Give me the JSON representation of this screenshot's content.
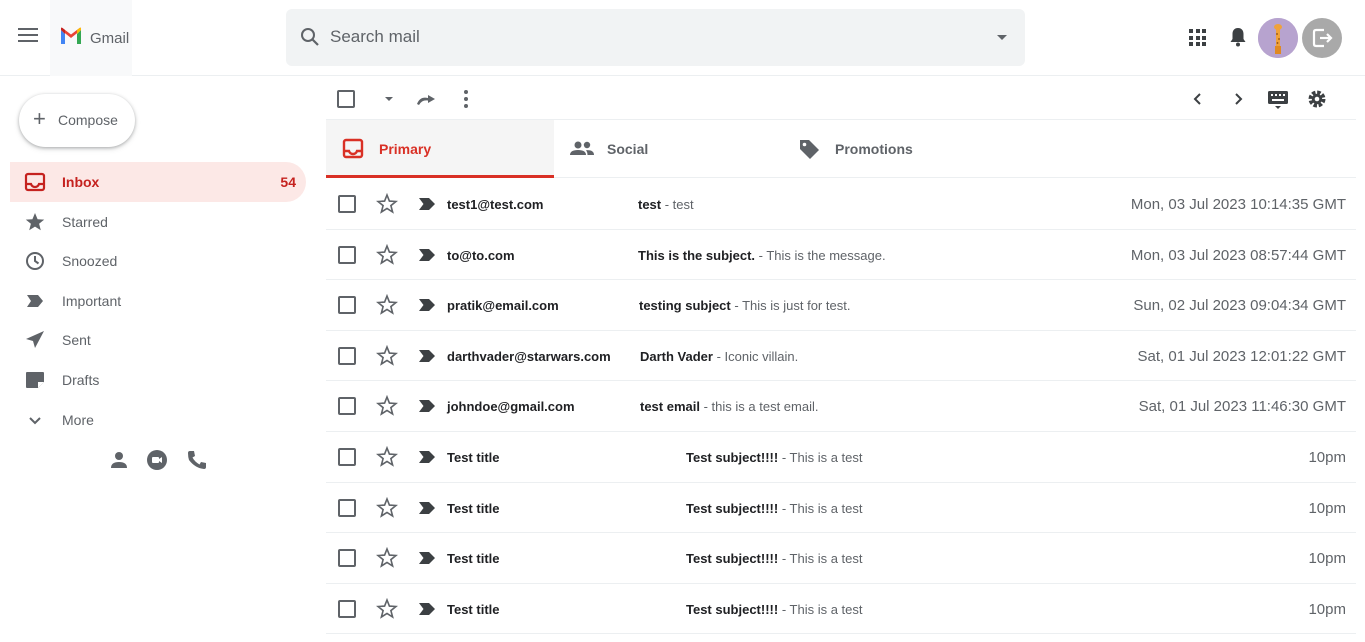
{
  "app": {
    "name": "Gmail"
  },
  "search": {
    "placeholder": "Search mail"
  },
  "sidebar": {
    "compose_label": "Compose",
    "items": [
      {
        "label": "Inbox",
        "icon": "inbox-icon",
        "count": "54",
        "active": true
      },
      {
        "label": "Starred",
        "icon": "star-icon"
      },
      {
        "label": "Snoozed",
        "icon": "clock-icon"
      },
      {
        "label": "Important",
        "icon": "important-icon"
      },
      {
        "label": "Sent",
        "icon": "send-icon"
      },
      {
        "label": "Drafts",
        "icon": "draft-icon"
      },
      {
        "label": "More",
        "icon": "chevron-down-icon"
      }
    ]
  },
  "tabs": [
    {
      "label": "Primary",
      "icon": "inbox-tab-icon",
      "active": true
    },
    {
      "label": "Social",
      "icon": "people-icon"
    },
    {
      "label": "Promotions",
      "icon": "tag-icon"
    }
  ],
  "emails": [
    {
      "sender": "test1@test.com",
      "subject": "test",
      "snippet": " - test",
      "date": "Mon, 03 Jul 2023 10:14:35 GMT"
    },
    {
      "sender": "to@to.com",
      "subject": "This is the subject.",
      "snippet": " - This is the message.",
      "date": "Mon, 03 Jul 2023 08:57:44 GMT"
    },
    {
      "sender": "pratik@email.com",
      "subject": "testing subject",
      "snippet": " - This is just for test.",
      "date": "Sun, 02 Jul 2023 09:04:34 GMT"
    },
    {
      "sender": "darthvader@starwars.com",
      "subject": "Darth Vader",
      "snippet": " - Iconic villain.",
      "date": "Sat, 01 Jul 2023 12:01:22 GMT"
    },
    {
      "sender": "johndoe@gmail.com",
      "subject": "test email",
      "snippet": " - this is a test email.",
      "date": "Sat, 01 Jul 2023 11:46:30 GMT"
    },
    {
      "sender": "Test title",
      "subject": "Test subject!!!!",
      "snippet": " - This is a test",
      "date": "10pm"
    },
    {
      "sender": "Test title",
      "subject": "Test subject!!!!",
      "snippet": " - This is a test",
      "date": "10pm"
    },
    {
      "sender": "Test title",
      "subject": "Test subject!!!!",
      "snippet": " - This is a test",
      "date": "10pm"
    },
    {
      "sender": "Test title",
      "subject": "Test subject!!!!",
      "snippet": " - This is a test",
      "date": "10pm"
    }
  ],
  "colors": {
    "accent": "#d93025",
    "inbox_active_bg": "#fce8e6",
    "icon_gray": "#5f6368"
  }
}
